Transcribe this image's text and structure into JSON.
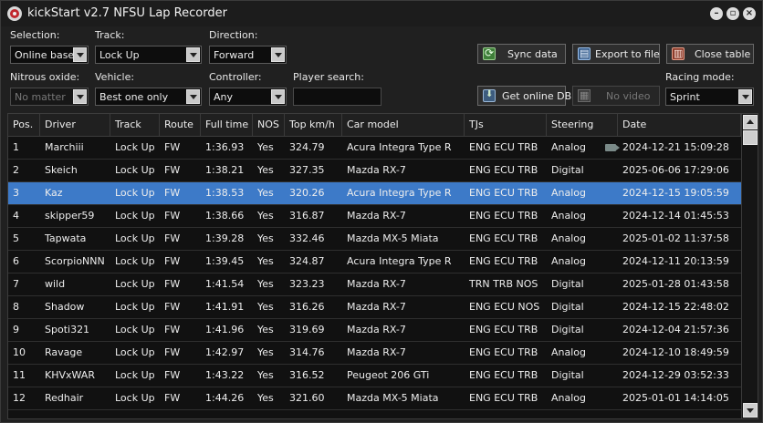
{
  "window": {
    "title": "kickStart v2.7 NFSU Lap Recorder",
    "icon": "app-logo-icon"
  },
  "filters": {
    "selection": {
      "label": "Selection:",
      "value": "Online base"
    },
    "track": {
      "label": "Track:",
      "value": "Lock Up"
    },
    "direction": {
      "label": "Direction:",
      "value": "Forward"
    },
    "nitrous": {
      "label": "Nitrous oxide:",
      "value": "No matter"
    },
    "vehicle": {
      "label": "Vehicle:",
      "value": "Best one only"
    },
    "controller": {
      "label": "Controller:",
      "value": "Any"
    },
    "player_search": {
      "label": "Player search:",
      "value": ""
    },
    "racing_mode": {
      "label": "Racing mode:",
      "value": "Sprint"
    }
  },
  "buttons": {
    "sync": "Sync data",
    "export": "Export to file",
    "close_table": "Close table",
    "get_online_db": "Get online DB",
    "no_video": "No video"
  },
  "table": {
    "columns": [
      "Pos.",
      "Driver",
      "Track",
      "Route",
      "Full time",
      "NOS",
      "Top km/h",
      "Car model",
      "TJs",
      "Steering",
      "Date"
    ],
    "selected_row": 2,
    "rows": [
      {
        "pos": "1",
        "driver": "Marchiii",
        "track": "Lock Up",
        "route": "FW",
        "time": "1:36.93",
        "nos": "Yes",
        "top": "324.79",
        "car": "Acura Integra Type R",
        "tjs": "ENG ECU TRB",
        "steering": "Analog",
        "date": "2024-12-21 15:09:28",
        "video": true
      },
      {
        "pos": "2",
        "driver": "Skeich",
        "track": "Lock Up",
        "route": "FW",
        "time": "1:38.21",
        "nos": "Yes",
        "top": "327.35",
        "car": "Mazda RX-7",
        "tjs": "ENG ECU TRB",
        "steering": "Digital",
        "date": "2025-06-06 17:29:06",
        "video": false
      },
      {
        "pos": "3",
        "driver": "Kaz",
        "track": "Lock Up",
        "route": "FW",
        "time": "1:38.53",
        "nos": "Yes",
        "top": "320.26",
        "car": "Acura Integra Type R",
        "tjs": "ENG ECU TRB",
        "steering": "Analog",
        "date": "2024-12-15 19:05:59",
        "video": false
      },
      {
        "pos": "4",
        "driver": "skipper59",
        "track": "Lock Up",
        "route": "FW",
        "time": "1:38.66",
        "nos": "Yes",
        "top": "316.87",
        "car": "Mazda RX-7",
        "tjs": "ENG ECU TRB",
        "steering": "Analog",
        "date": "2024-12-14 01:45:53",
        "video": false
      },
      {
        "pos": "5",
        "driver": "Tapwata",
        "track": "Lock Up",
        "route": "FW",
        "time": "1:39.28",
        "nos": "Yes",
        "top": "332.46",
        "car": "Mazda MX-5 Miata",
        "tjs": "ENG ECU TRB",
        "steering": "Analog",
        "date": "2025-01-02 11:37:58",
        "video": false
      },
      {
        "pos": "6",
        "driver": "ScorpioNNN",
        "track": "Lock Up",
        "route": "FW",
        "time": "1:39.45",
        "nos": "Yes",
        "top": "324.87",
        "car": "Acura Integra Type R",
        "tjs": "ENG ECU TRB",
        "steering": "Analog",
        "date": "2024-12-11 20:13:59",
        "video": false
      },
      {
        "pos": "7",
        "driver": "wild",
        "track": "Lock Up",
        "route": "FW",
        "time": "1:41.54",
        "nos": "Yes",
        "top": "323.23",
        "car": "Mazda RX-7",
        "tjs": "TRN TRB NOS",
        "steering": "Digital",
        "date": "2025-01-28 01:43:58",
        "video": false
      },
      {
        "pos": "8",
        "driver": "Shadow",
        "track": "Lock Up",
        "route": "FW",
        "time": "1:41.91",
        "nos": "Yes",
        "top": "316.26",
        "car": "Mazda RX-7",
        "tjs": "ENG ECU NOS",
        "steering": "Digital",
        "date": "2024-12-15 22:48:02",
        "video": false
      },
      {
        "pos": "9",
        "driver": "Spoti321",
        "track": "Lock Up",
        "route": "FW",
        "time": "1:41.96",
        "nos": "Yes",
        "top": "319.69",
        "car": "Mazda RX-7",
        "tjs": "ENG ECU TRB",
        "steering": "Digital",
        "date": "2024-12-04 21:57:36",
        "video": false
      },
      {
        "pos": "10",
        "driver": "Ravage",
        "track": "Lock Up",
        "route": "FW",
        "time": "1:42.97",
        "nos": "Yes",
        "top": "314.76",
        "car": "Mazda RX-7",
        "tjs": "ENG ECU TRB",
        "steering": "Analog",
        "date": "2024-12-10 18:49:59",
        "video": false
      },
      {
        "pos": "11",
        "driver": "KHVxWAR",
        "track": "Lock Up",
        "route": "FW",
        "time": "1:43.22",
        "nos": "Yes",
        "top": "316.52",
        "car": "Peugeot 206 GTi",
        "tjs": "ENG ECU TRB",
        "steering": "Digital",
        "date": "2024-12-29 03:52:33",
        "video": false
      },
      {
        "pos": "12",
        "driver": "Redhair",
        "track": "Lock Up",
        "route": "FW",
        "time": "1:44.26",
        "nos": "Yes",
        "top": "321.60",
        "car": "Mazda MX-5 Miata",
        "tjs": "ENG ECU TRB",
        "steering": "Analog",
        "date": "2025-01-01 14:14:05",
        "video": false
      }
    ]
  },
  "colors": {
    "selection": "#3d7ac8",
    "background": "#111111",
    "header": "#202020"
  }
}
